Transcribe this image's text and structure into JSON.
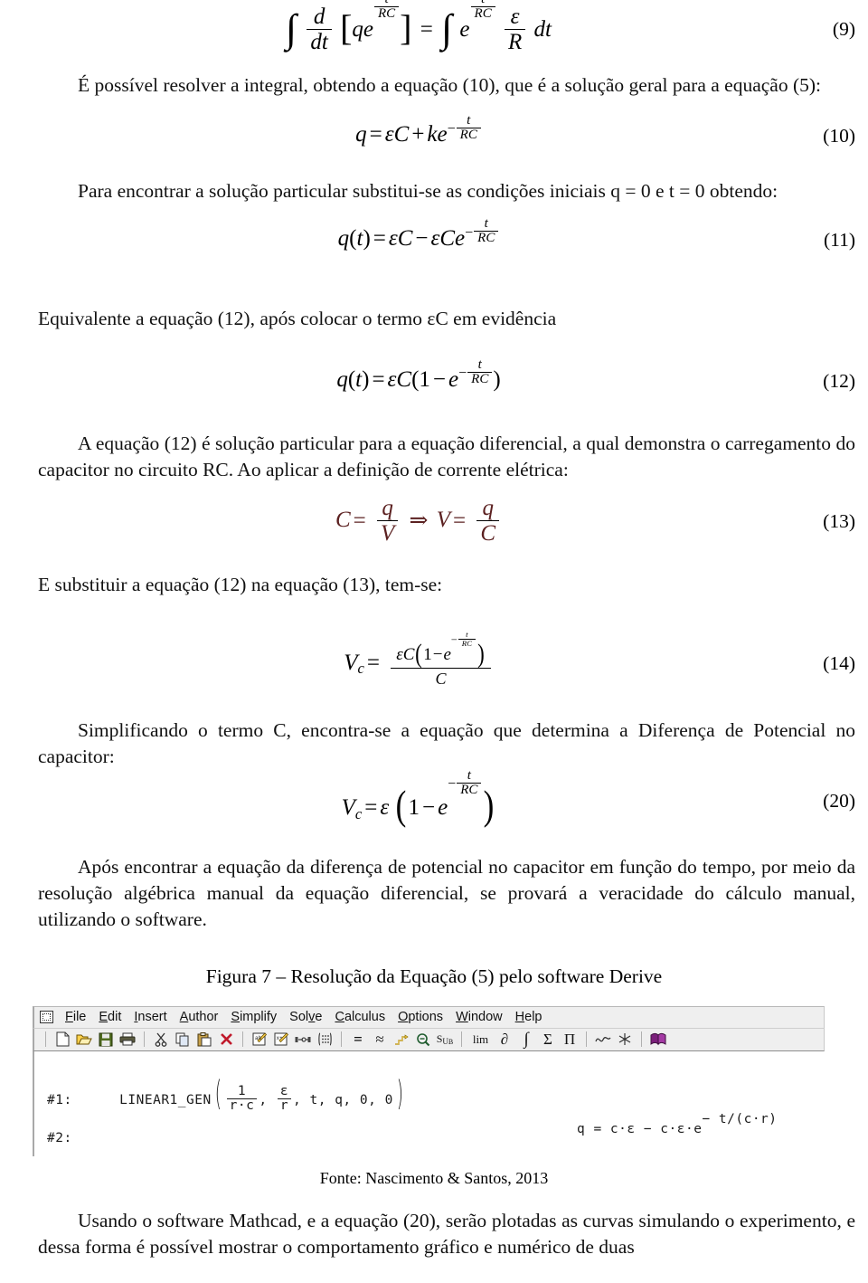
{
  "document": {
    "language": "pt-BR",
    "equations": {
      "eq9": {
        "number": "(9)",
        "latex": "∫ d/dt [q e^(t/RC)] = ∫ e^(t/RC) ε/R dt"
      },
      "eq10": {
        "number": "(10)",
        "latex": "q = εC + k e^(−t/RC)"
      },
      "eq11": {
        "number": "(11)",
        "latex": "q(t) = εC − εC e^(−t/RC)"
      },
      "eq12": {
        "number": "(12)",
        "latex": "q(t) = εC(1 − e^(−t/RC))"
      },
      "eq13": {
        "number": "(13)",
        "latex": "C = q/V ⇒ V = q/C"
      },
      "eq14": {
        "number": "(14)",
        "latex": "V_c = εC(1 − e^(−t/RC)) / C"
      },
      "eq20": {
        "number": "(20)",
        "latex": "V_c = ε(1 − e^(−t/RC))"
      }
    },
    "paragraphs": {
      "p1": "É possível resolver a integral, obtendo a equação (10), que é a solução geral para a equação (5):",
      "p2": "Para encontrar a solução particular substitui-se as condições iniciais q = 0 e t = 0 obtendo:",
      "p3": "Equivalente a equação (12), após colocar o termo εC em evidência",
      "p4": "A equação (12) é solução particular para a equação diferencial, a qual demonstra o carregamento do capacitor no circuito RC. Ao aplicar a definição de corrente elétrica:",
      "p5": "E substituir a equação (12) na equação (13), tem-se:",
      "p6": "Simplificando o termo C,  encontra-se a equação que determina a Diferença de Potencial no capacitor:",
      "p7": "Após encontrar a equação da diferença de potencial no capacitor em função do tempo, por meio da resolução algébrica manual da equação diferencial, se provará a veracidade do cálculo manual, utilizando o software.",
      "p8": "Usando o software Mathcad, e a equação (20), serão plotadas as curvas simulando o experimento, e dessa forma é possível mostrar o comportamento gráfico e numérico de duas"
    },
    "figure": {
      "caption": "Figura 7 – Resolução da Equação (5) pelo software Derive",
      "source": "Fonte: Nascimento & Santos, 2013"
    }
  },
  "derive_app": {
    "menu": [
      {
        "label": "File",
        "accel": "F"
      },
      {
        "label": "Edit",
        "accel": "E"
      },
      {
        "label": "Insert",
        "accel": "I"
      },
      {
        "label": "Author",
        "accel": "A"
      },
      {
        "label": "Simplify",
        "accel": "S"
      },
      {
        "label": "Solve",
        "accel": "v"
      },
      {
        "label": "Calculus",
        "accel": "C"
      },
      {
        "label": "Options",
        "accel": "O"
      },
      {
        "label": "Window",
        "accel": "W"
      },
      {
        "label": "Help",
        "accel": "H"
      }
    ],
    "toolbar": [
      {
        "name": "new-file-icon",
        "glyph": ""
      },
      {
        "name": "open-folder-icon",
        "glyph": ""
      },
      {
        "name": "save-disk-icon",
        "glyph": ""
      },
      {
        "name": "print-icon",
        "glyph": ""
      },
      {
        "name": "cut-scissors-icon",
        "glyph": ""
      },
      {
        "name": "copy-icon",
        "glyph": ""
      },
      {
        "name": "paste-icon",
        "glyph": ""
      },
      {
        "name": "delete-x-icon",
        "glyph": "✕"
      },
      {
        "name": "author-expression-icon",
        "glyph": ""
      },
      {
        "name": "author-vector-icon",
        "glyph": ""
      },
      {
        "name": "substitute-icon",
        "glyph": ""
      },
      {
        "name": "matrix-icon",
        "glyph": ""
      },
      {
        "name": "simplify-equals-icon",
        "glyph": "="
      },
      {
        "name": "approximate-icon",
        "glyph": "≈"
      },
      {
        "name": "solve-step-icon",
        "glyph": ""
      },
      {
        "name": "zoom-expression-icon",
        "glyph": ""
      },
      {
        "name": "substitute-sub-icon",
        "glyph": "Sub"
      },
      {
        "name": "limit-icon",
        "glyph": "lim"
      },
      {
        "name": "partial-derivative-icon",
        "glyph": "∂"
      },
      {
        "name": "integral-icon",
        "glyph": "∫"
      },
      {
        "name": "sum-icon",
        "glyph": "Σ"
      },
      {
        "name": "product-icon",
        "glyph": "Π"
      },
      {
        "name": "plot-2d-icon",
        "glyph": "∿"
      },
      {
        "name": "plot-3d-icon",
        "glyph": ""
      },
      {
        "name": "help-book-icon",
        "glyph": ""
      }
    ],
    "expressions": [
      {
        "label": "#1:",
        "function": "LINEAR1_GEN",
        "arg1_num": "1",
        "arg1_den": "r·c",
        "arg2_num": "ε",
        "arg2_den": "r",
        "args_rest": ", t, q, 0, 0"
      },
      {
        "label": "#2:",
        "result_lhs": "q = c·ε − c·ε·e",
        "result_exponent": "− t/(c·r)"
      }
    ]
  }
}
